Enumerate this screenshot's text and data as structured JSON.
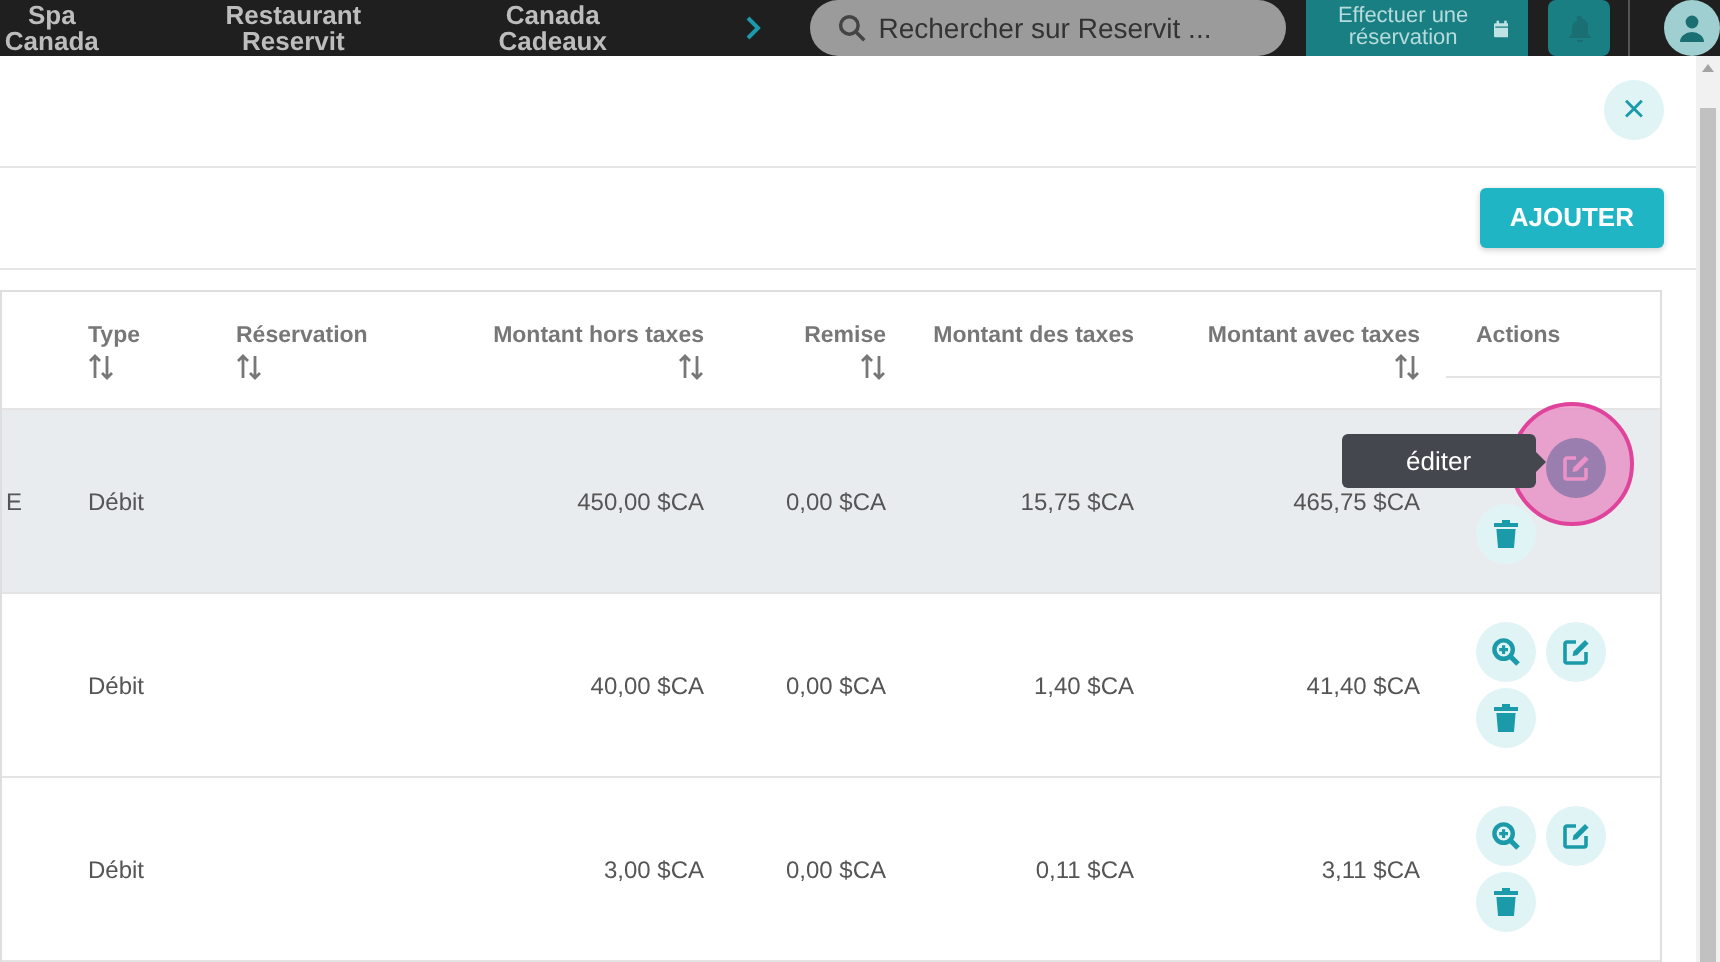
{
  "top_bar": {
    "nav_items": [
      {
        "lines": [
          "Spa",
          "Canada"
        ]
      },
      {
        "lines": [
          "Restaurant",
          "Reservit"
        ]
      },
      {
        "lines": [
          "Canada",
          "Cadeaux"
        ]
      }
    ],
    "search": {
      "placeholder": "Rechercher sur Reservit ..."
    },
    "booking_button": {
      "label": "Effectuer une réservation"
    }
  },
  "dialog": {
    "close": "×",
    "add_button": "AJOUTER"
  },
  "table": {
    "columns": [
      {},
      {
        "label": "Type",
        "sortable": true
      },
      {
        "label": "Réservation",
        "sortable": true
      },
      {
        "label": "Montant hors taxes",
        "sortable": true
      },
      {
        "label": "Remise",
        "sortable": true
      },
      {
        "label": "Montant des taxes",
        "sortable": false
      },
      {
        "label": "Montant avec taxes",
        "sortable": true
      },
      {
        "label": "Actions",
        "sortable": false
      }
    ],
    "rows": [
      {
        "highlighted": true,
        "cells": [
          "E",
          "Débit",
          "",
          "450,00 $CA",
          "0,00 $CA",
          "15,75 $CA",
          "465,75 $CA"
        ],
        "actions": [
          {
            "kind": "edit",
            "focused": true,
            "tooltip": "éditer"
          },
          {
            "kind": "delete",
            "focused": false
          }
        ]
      },
      {
        "highlighted": false,
        "cells": [
          "",
          "Débit",
          "",
          "40,00 $CA",
          "0,00 $CA",
          "1,40 $CA",
          "41,40 $CA"
        ],
        "actions": [
          {
            "kind": "zoom",
            "focused": false
          },
          {
            "kind": "edit",
            "focused": false
          },
          {
            "kind": "delete",
            "focused": false
          }
        ]
      },
      {
        "highlighted": false,
        "cells": [
          "",
          "Débit",
          "",
          "3,00 $CA",
          "0,00 $CA",
          "0,11 $CA",
          "3,11 $CA"
        ],
        "actions": [
          {
            "kind": "zoom",
            "focused": false
          },
          {
            "kind": "edit",
            "focused": false
          },
          {
            "kind": "delete",
            "focused": false
          }
        ]
      }
    ]
  }
}
